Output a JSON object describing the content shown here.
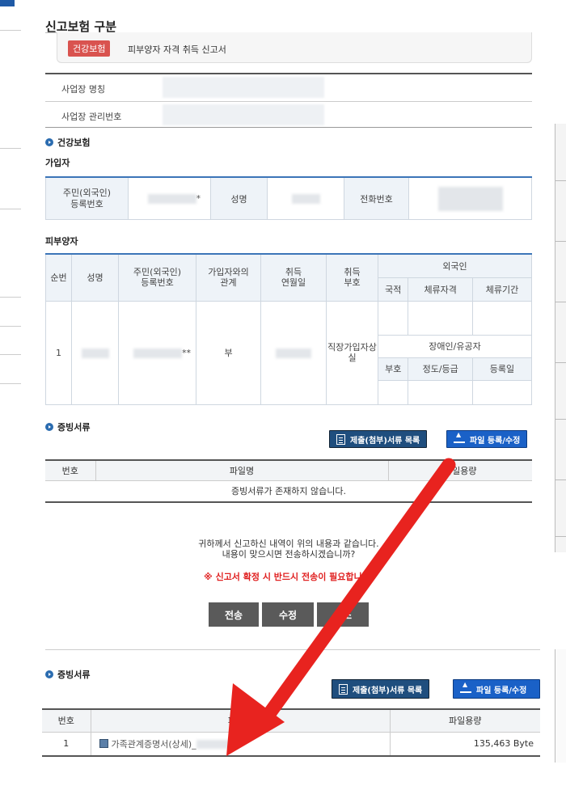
{
  "page": {
    "title": "신고보험 구분",
    "insurance_badge": "건강보험",
    "report_type": "피부양자 자격 취득 신고서"
  },
  "business": {
    "name_label": "사업장 명칭",
    "number_label": "사업장 관리번호"
  },
  "health_section": {
    "heading": "건강보험",
    "subscriber_heading": "가입자",
    "subscriber": {
      "id_label": "주민(외국인)\n등록번호",
      "id_suffix": "*",
      "name_label": "성명",
      "phone_label": "전화번호"
    },
    "dependents_heading": "피부양자",
    "dependents_headers": {
      "seq": "순번",
      "name": "성명",
      "id": "주민(외국인)\n등록번호",
      "relation": "가입자와의\n관계",
      "acq_date": "취득\n연월일",
      "acq_code": "취득\n부호",
      "foreigner": "외국인",
      "nationality": "국적",
      "status": "체류자격",
      "period": "체류기간",
      "disabled": "장애인/유공자",
      "code": "부호",
      "grade": "정도/등급",
      "reg_date": "등록일"
    },
    "dependent_row": {
      "seq": "1",
      "id_suffix": "**",
      "relation": "부",
      "acq_code": "직장가입자상\n실"
    }
  },
  "evidence_top": {
    "heading": "증빙서류",
    "list_button": "제출(첨부)서류 목록",
    "upload_button": "파일 등록/수정",
    "col_no": "번호",
    "col_name": "파일명",
    "col_size": "파일용량",
    "empty_message": "증빙서류가 존재하지 않습니다."
  },
  "confirm": {
    "line1": "귀하께서 신고하신 내역이 위의 내용과 같습니다.",
    "line2": "내용이 맞으시면 전송하시겠습니까?",
    "warning": "※ 신고서 확정 시 반드시 전송이 필요합니다.",
    "send_button": "전송",
    "edit_button": "수정",
    "cancel_button": "취소"
  },
  "evidence_bottom": {
    "heading": "증빙서류",
    "list_button": "제출(첨부)서류 목록",
    "upload_button": "파일 등록/수정",
    "col_no": "번호",
    "col_name": "파일명",
    "col_size": "파일용량",
    "rows": [
      {
        "no": "1",
        "file": "가족관계증명서(상세)_",
        "size": "135,463 Byte"
      }
    ]
  },
  "colors": {
    "badge": "#d9534f",
    "arrow": "#e8231f",
    "table_top_border": "#3c75b8",
    "button_blue": "#1a61c7"
  }
}
